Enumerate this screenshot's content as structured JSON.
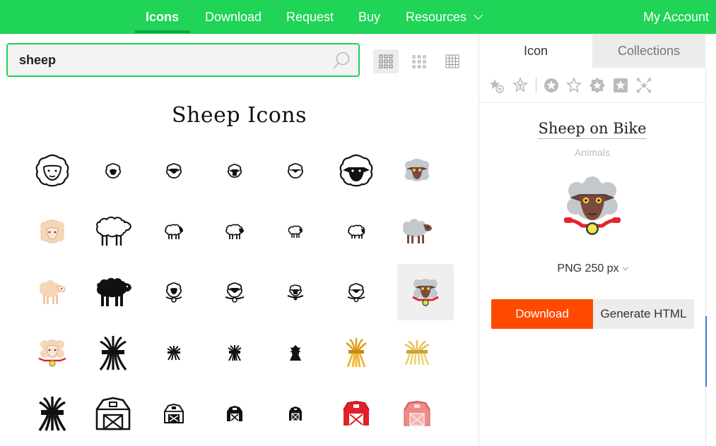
{
  "nav": {
    "items": [
      "Icons",
      "Download",
      "Request",
      "Buy",
      "Resources"
    ],
    "account": "My Account"
  },
  "search": {
    "value": "sheep",
    "placeholder": ""
  },
  "view_modes": [
    "grid-large-icon",
    "grid-medium-icon",
    "grid-small-icon"
  ],
  "page_title": "Sheep Icons",
  "grid": {
    "rows": [
      [
        "sheep-face-outline-icon",
        "sheep-face-small-icon",
        "sheep-face-filled-icon",
        "sheep-face-tiny-icon",
        "sheep-face-mini-icon",
        "sheep-face-black-icon",
        "sheep-face-color-icon"
      ],
      [
        "sheep-face-beige-icon",
        "sheep-body-outline-icon",
        "sheep-body-medium-icon",
        "sheep-body-small-icon",
        "sheep-body-tiny-icon",
        "sheep-body-mini-icon",
        "sheep-body-grey-icon"
      ],
      [
        "sheep-body-beige-icon",
        "sheep-body-black-icon",
        "sheep-bike-outline-icon",
        "sheep-bike-medium-icon",
        "sheep-bike-small-icon",
        "sheep-bike-mini-icon",
        "sheep-on-bike-color-icon"
      ],
      [
        "sheep-bike-beige-icon",
        "wheat-bundle-large-icon",
        "wheat-bundle-small-icon",
        "wheat-bundle-medium-icon",
        "wheat-bundle-tiny-icon",
        "wheat-bundle-gold-icon",
        "wheat-bundle-yellow-icon"
      ],
      [
        "wheat-bundle-black-icon",
        "barn-outline-icon",
        "barn-small-icon",
        "barn-filled-icon",
        "barn-tiny-icon",
        "barn-red-icon",
        "barn-pink-icon"
      ]
    ],
    "selected": "sheep-on-bike-color-icon"
  },
  "panel": {
    "tabs": [
      "Icon",
      "Collections"
    ],
    "tools": [
      "star-add-icon",
      "star-text-icon",
      "star-circle-icon",
      "star-outline-icon",
      "star-square-icon",
      "star-filled-square-icon",
      "star-expand-icon"
    ],
    "title": "Sheep on Bike",
    "category": "Animals",
    "size": "PNG 250 px",
    "download": "Download",
    "generate_html": "Generate HTML"
  },
  "colors": {
    "brand": "#1fd457",
    "download": "#ff4a00",
    "sheep_wool": "#bfc4c9",
    "sheep_face": "#7a4a3a",
    "bike_red": "#e0262e"
  }
}
